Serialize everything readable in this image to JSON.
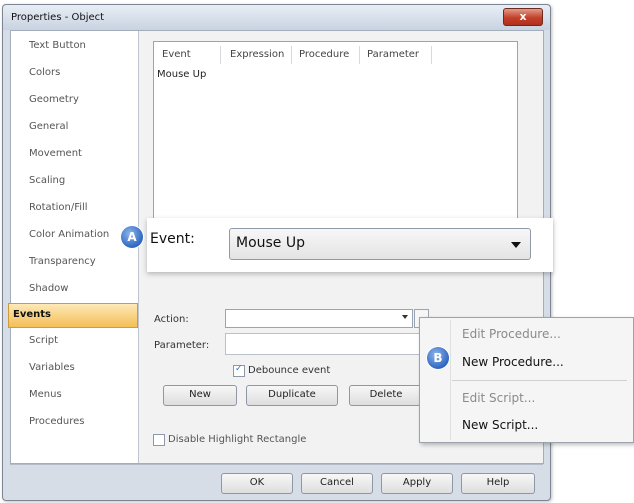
{
  "window": {
    "title": "Properties - Object",
    "close_label": "x"
  },
  "sidebar": {
    "items": [
      "Text Button",
      "Colors",
      "Geometry",
      "General",
      "Movement",
      "Scaling",
      "Rotation/Fill",
      "Color Animation",
      "Transparency",
      "Shadow",
      "Events",
      "Script",
      "Variables",
      "Menus",
      "Procedures"
    ],
    "active": "Events"
  },
  "events_table": {
    "columns": [
      "Event",
      "Expression",
      "Procedure",
      "Parameter"
    ],
    "rows": [
      [
        "Mouse Up",
        "",
        "",
        ""
      ]
    ]
  },
  "callout": {
    "label": "Event:",
    "value": "Mouse Up",
    "badge": "A"
  },
  "form": {
    "action_label": "Action:",
    "action_value": "",
    "parameter_label": "Parameter:",
    "parameter_value": "",
    "debounce_label": "Debounce event",
    "debounce_checked": true,
    "new_label": "New",
    "duplicate_label": "Duplicate",
    "delete_label": "Delete",
    "disable_highlight_label": "Disable Highlight Rectangle",
    "disable_highlight_checked": false
  },
  "footer": {
    "ok": "OK",
    "cancel": "Cancel",
    "apply": "Apply",
    "help": "Help"
  },
  "context_menu": {
    "badge": "B",
    "items": [
      {
        "label": "Edit Procedure...",
        "enabled": false
      },
      {
        "label": "New Procedure...",
        "enabled": true
      },
      {
        "label": "Edit Script...",
        "enabled": false
      },
      {
        "label": "New Script...",
        "enabled": true
      }
    ]
  },
  "colors": {
    "accent": "#f5be57",
    "badge": "#2f67c0",
    "close": "#c3402a"
  }
}
